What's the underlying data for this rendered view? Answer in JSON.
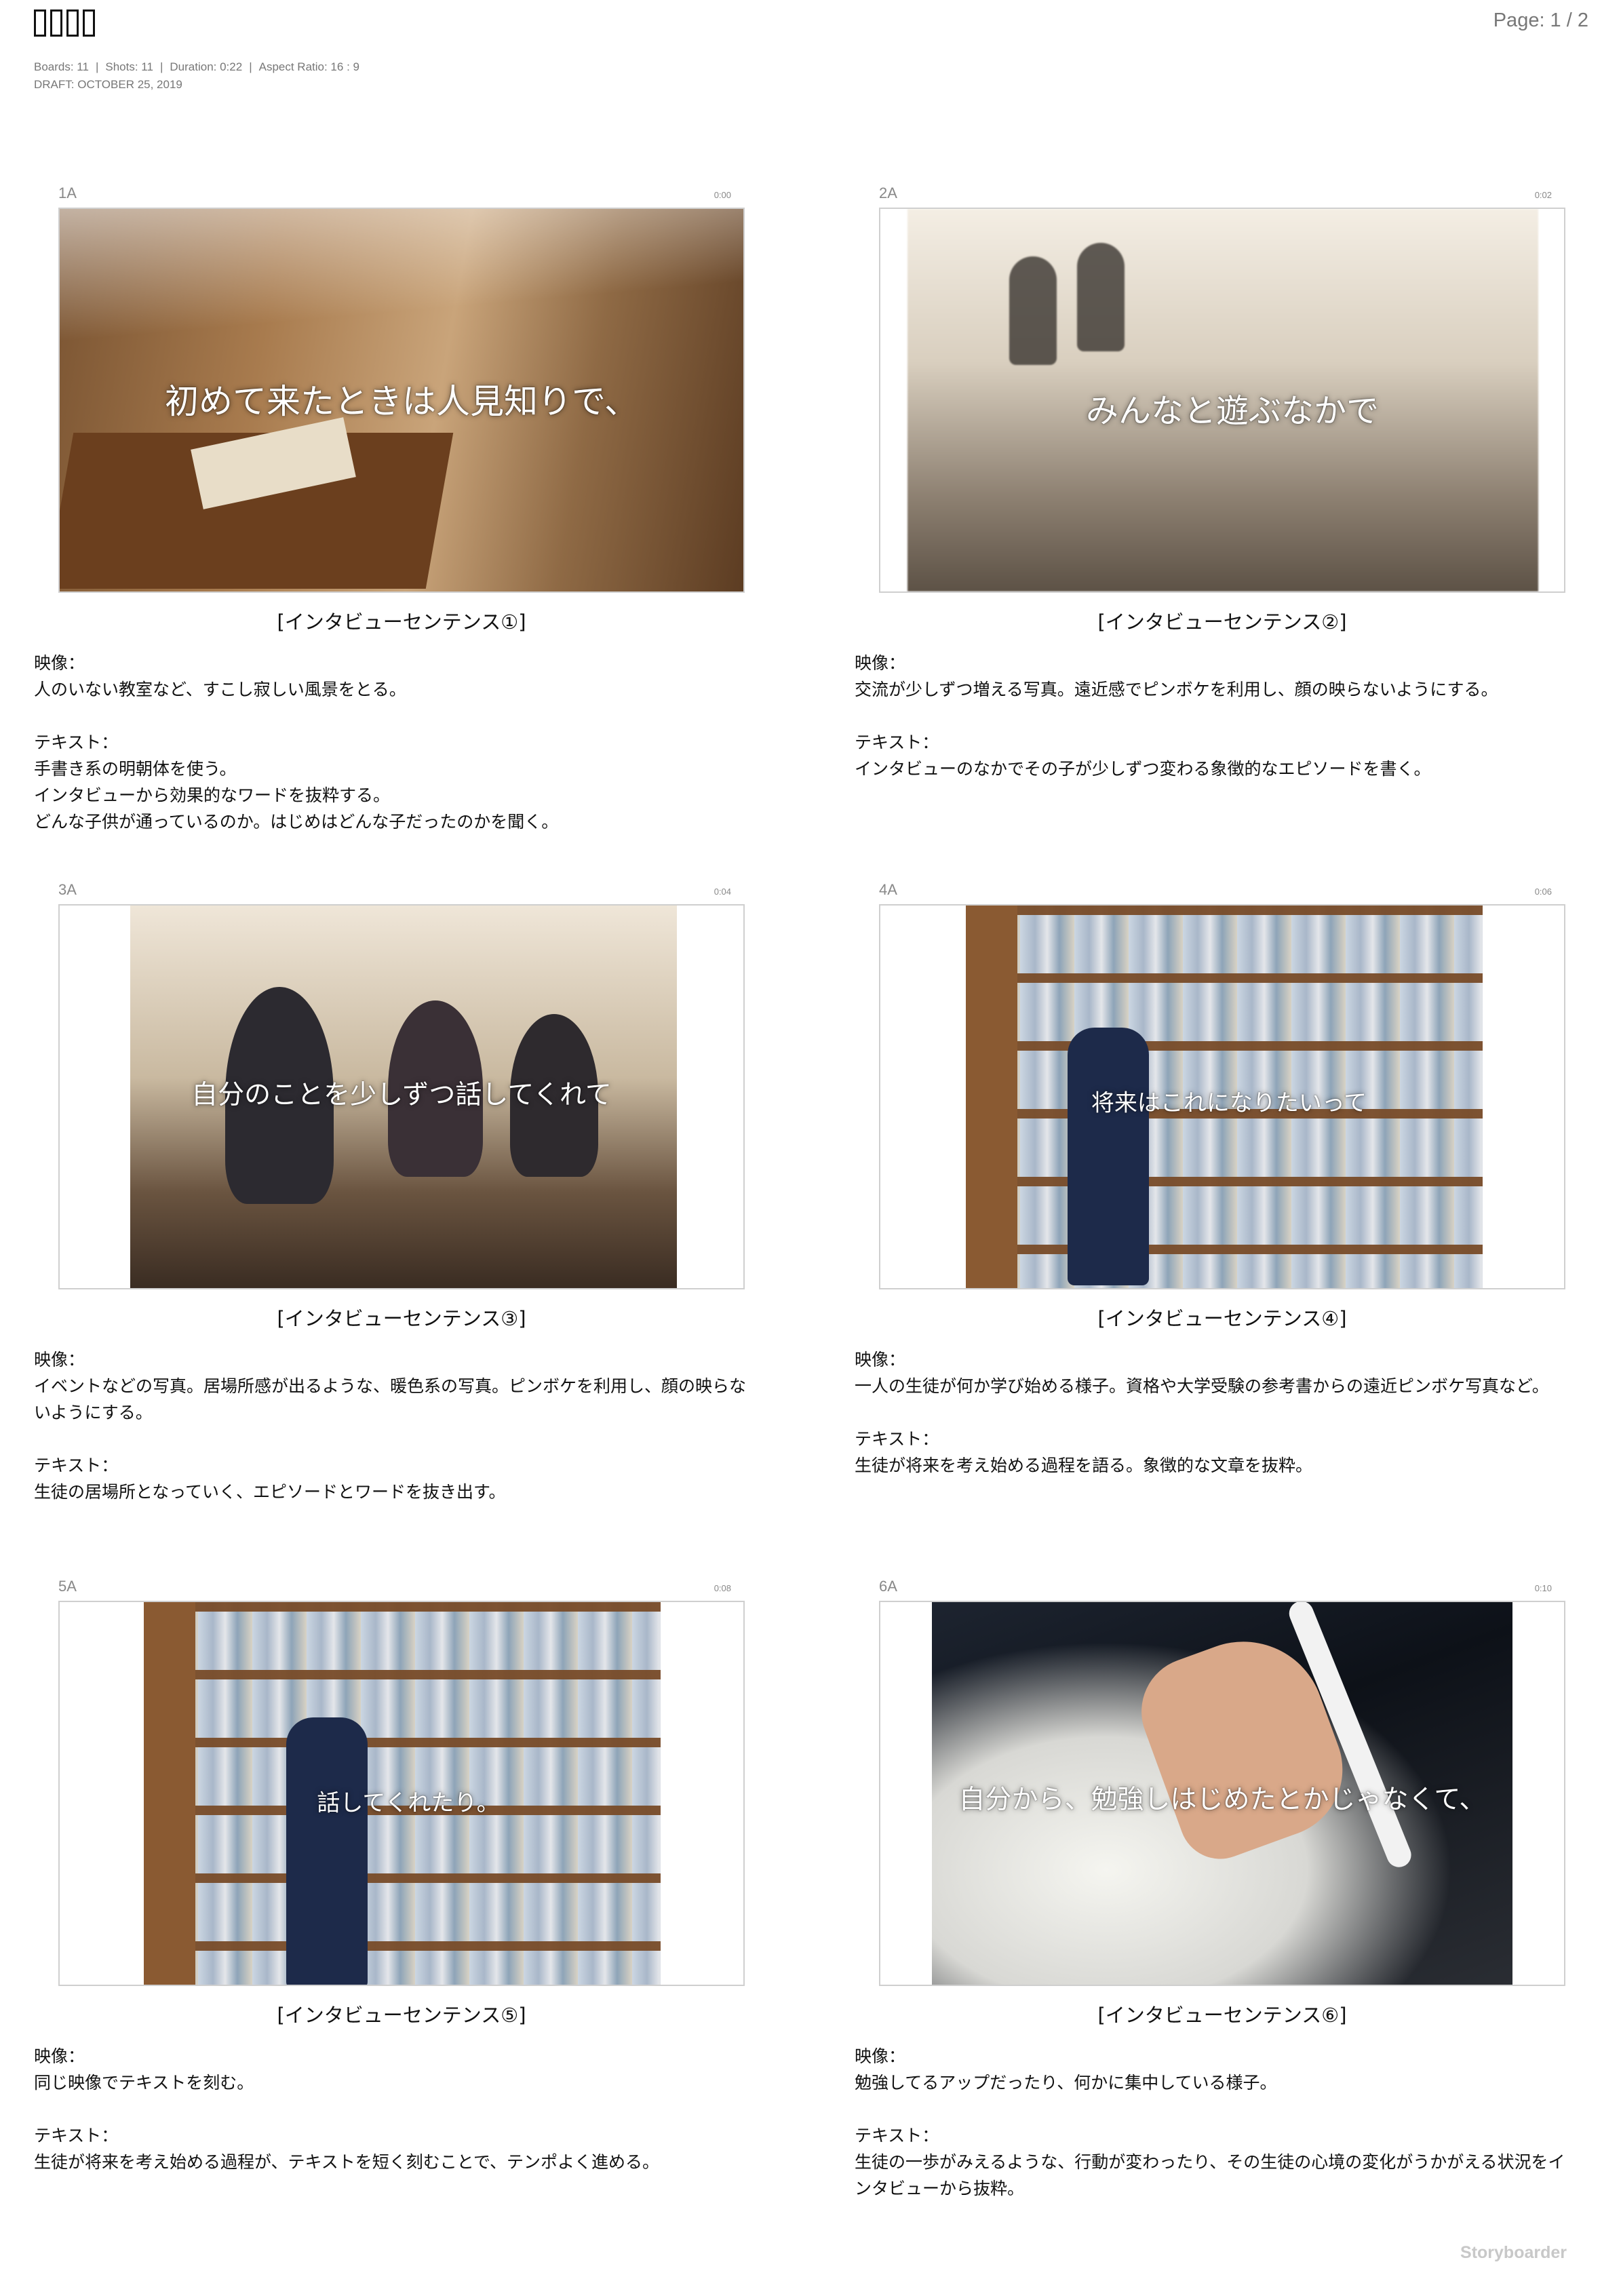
{
  "header": {
    "title_glyph_count": 4,
    "boards": "Boards: 11",
    "shots": "Shots: 11",
    "duration": "Duration: 0:22",
    "aspect": "Aspect Ratio: 16 : 9",
    "draft": "DRAFT: OCTOBER 25, 2019",
    "page": "Page: 1 / 2"
  },
  "boards": [
    {
      "id": "1A",
      "time": "0:00",
      "overlay": "初めて来たときは人見知りで、",
      "caption": "[インタビューセンテンス①]",
      "video_label": "映像：",
      "video": "人のいない教室など、すこし寂しい風景をとる。",
      "text_label": "テキスト：",
      "text_lines": [
        "手書き系の明朝体を使う。",
        "インタビューから効果的なワードを抜粋する。",
        "どんな子供が通っているのか。はじめはどんな子だったのかを聞く。"
      ]
    },
    {
      "id": "2A",
      "time": "0:02",
      "overlay": "みんなと遊ぶなかで",
      "caption": "[インタビューセンテンス②]",
      "video_label": "映像：",
      "video": "交流が少しずつ増える写真。遠近感でピンボケを利用し、顔の映らないようにする。",
      "text_label": "テキスト：",
      "text_lines": [
        "インタビューのなかでその子が少しずつ変わる象徴的なエピソードを書く。"
      ]
    },
    {
      "id": "3A",
      "time": "0:04",
      "overlay": "自分のことを少しずつ話してくれて",
      "caption": "[インタビューセンテンス③]",
      "video_label": "映像：",
      "video": "イベントなどの写真。居場所感が出るような、暖色系の写真。ピンボケを利用し、顔の映らないようにする。",
      "text_label": "テキスト：",
      "text_lines": [
        "生徒の居場所となっていく、エピソードとワードを抜き出す。"
      ]
    },
    {
      "id": "4A",
      "time": "0:06",
      "overlay": "将来はこれになりたいって",
      "caption": "[インタビューセンテンス④]",
      "video_label": "映像：",
      "video": "一人の生徒が何か学び始める様子。資格や大学受験の参考書からの遠近ピンボケ写真など。",
      "text_label": "テキスト：",
      "text_lines": [
        "生徒が将来を考え始める過程を語る。象徴的な文章を抜粋。"
      ]
    },
    {
      "id": "5A",
      "time": "0:08",
      "overlay": "話してくれたり。",
      "caption": "[インタビューセンテンス⑤]",
      "video_label": "映像：",
      "video": "同じ映像でテキストを刻む。",
      "text_label": "テキスト：",
      "text_lines": [
        "生徒が将来を考え始める過程が、テキストを短く刻むことで、テンポよく進める。"
      ]
    },
    {
      "id": "6A",
      "time": "0:10",
      "overlay": "自分から、勉強しはじめたとかじゃなくて、",
      "caption": "[インタビューセンテンス⑥]",
      "video_label": "映像：",
      "video": "勉強してるアップだったり、何かに集中している様子。",
      "text_label": "テキスト：",
      "text_lines": [
        "生徒の一歩がみえるような、行動が変わったり、その生徒の心境の変化がうかがえる状況をインタビューから抜粋。"
      ]
    }
  ],
  "footer": "Storyboarder"
}
